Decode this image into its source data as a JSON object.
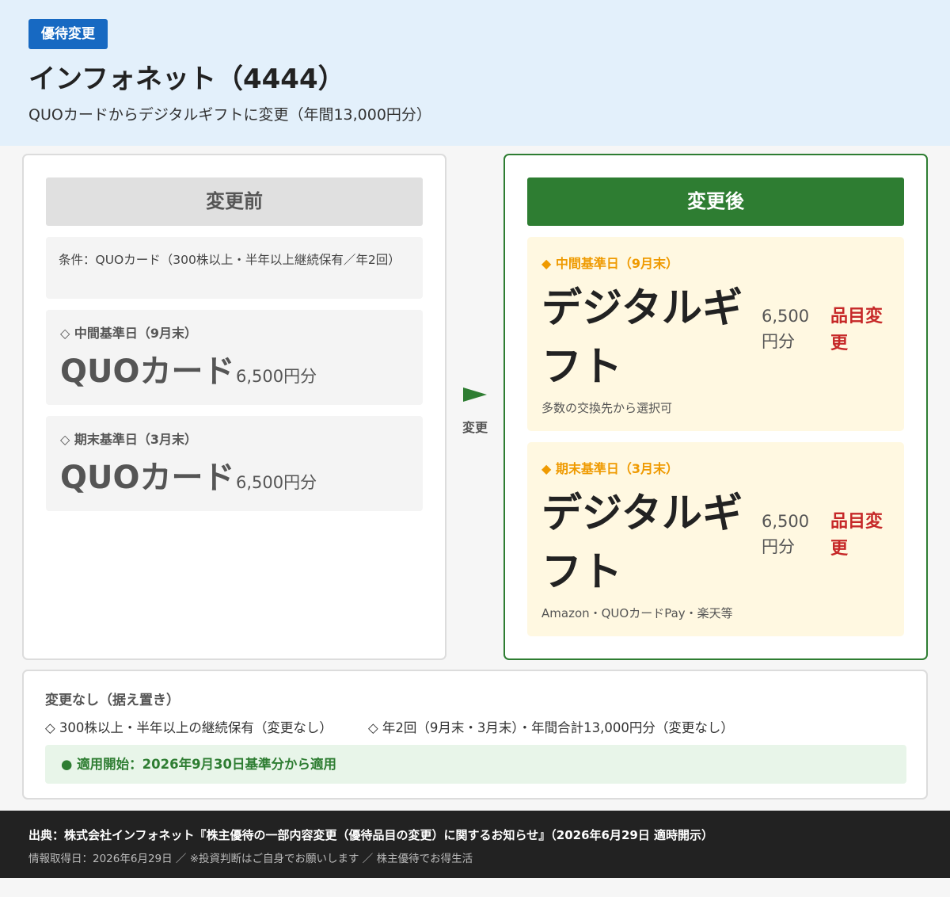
{
  "header": {
    "badge": "優待変更",
    "title": "インフォネット（4444）",
    "subtitle": "QUOカードからデジタルギフトに変更（年間13,000円分）"
  },
  "before": {
    "heading": "変更前",
    "condition": "条件：QUOカード（300株以上・半年以上継続保有／年2回）",
    "items": [
      {
        "label": "◇ 中間基準日（9月末）",
        "name": "QUOカード",
        "amount": "6,500円分"
      },
      {
        "label": "◇ 期末基準日（3月末）",
        "name": "QUOカード",
        "amount": "6,500円分"
      }
    ]
  },
  "arrow": {
    "label": "変更",
    "icon": "arrow-right-icon",
    "color": "#2e7d32"
  },
  "after": {
    "heading": "変更後",
    "items": [
      {
        "label": "◆ 中間基準日（9月末）",
        "name": "デジタルギフト",
        "amount": "6,500円分",
        "tag": "品目変更",
        "note": "多数の交換先から選択可"
      },
      {
        "label": "◆ 期末基準日（3月末）",
        "name": "デジタルギフト",
        "amount": "6,500円分",
        "tag": "品目変更",
        "note": "Amazon・QUOカードPay・楽天等"
      }
    ]
  },
  "no_change": {
    "heading": "変更なし（据え置き）",
    "items": [
      "◇ 300株以上・半年以上の継続保有（変更なし）",
      "◇ 年2回（9月末・3月末）・年間合計13,000円分（変更なし）"
    ],
    "apply_start": "● 適用開始：2026年9月30日基準分から適用"
  },
  "footer": {
    "source": "出典：株式会社インフォネット『株主優待の一部内容変更（優待品目の変更）に関するお知らせ』（2026年6月29日 適時開示）",
    "meta": "情報取得日：2026年6月29日 ／ ※投資判断はご自身でお願いします ／ 株主優待でお得生活"
  },
  "colors": {
    "accent_blue": "#1769c2",
    "accent_green": "#2e7d32",
    "highlight_orange": "#ef9a00",
    "tag_red": "#c62828"
  }
}
